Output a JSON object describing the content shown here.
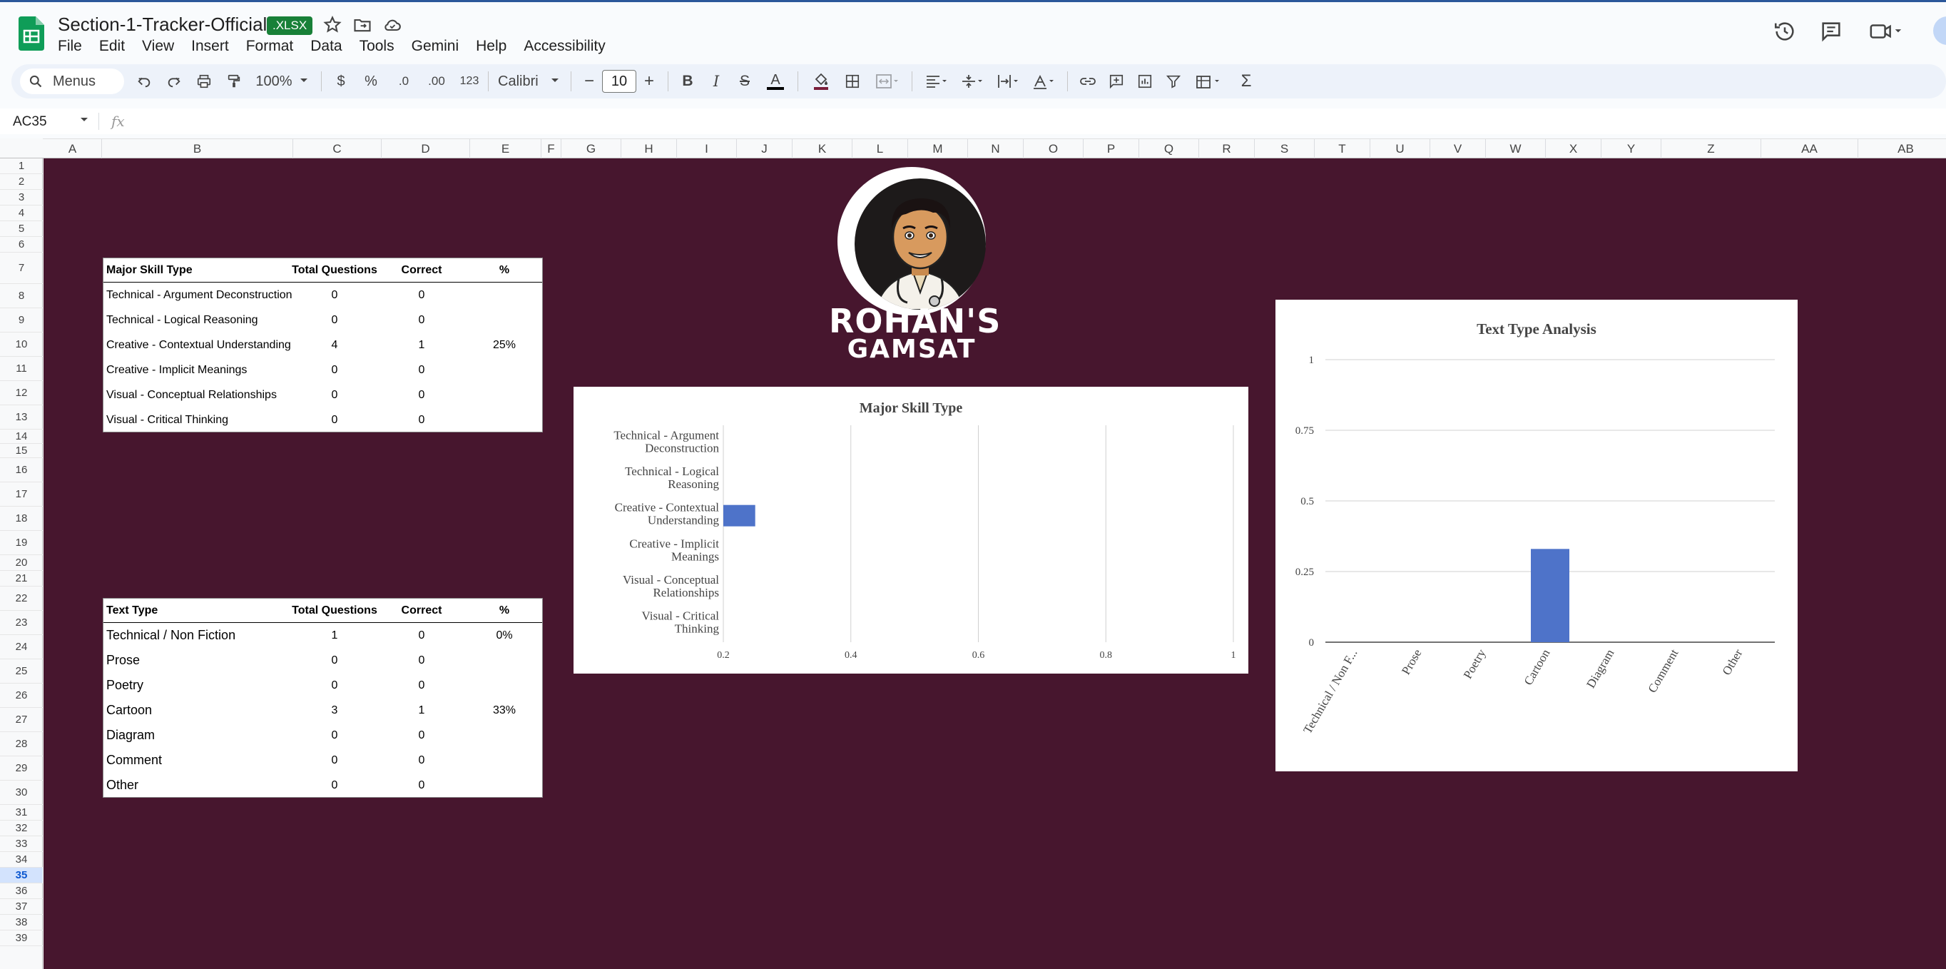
{
  "app": {
    "doc_title": "Section-1-Tracker-Official",
    "format_badge": ".XLSX"
  },
  "menubar": [
    "File",
    "Edit",
    "View",
    "Insert",
    "Format",
    "Data",
    "Tools",
    "Gemini",
    "Help",
    "Accessibility"
  ],
  "toolbar": {
    "menus_label": "Menus",
    "zoom": "100%",
    "currency": "$",
    "percent": "%",
    "decrease_decimal": ".0",
    "increase_decimal": ".00",
    "more_formats": "123",
    "font_family": "Calibri",
    "font_size": "10"
  },
  "formula_bar": {
    "name_box": "AC35",
    "fx": "fx"
  },
  "columns": [
    "A",
    "B",
    "C",
    "D",
    "E",
    "F",
    "G",
    "H",
    "I",
    "J",
    "K",
    "L",
    "M",
    "N",
    "O",
    "P",
    "Q",
    "R",
    "S",
    "T",
    "U",
    "V",
    "W",
    "X",
    "Y",
    "Z",
    "AA",
    "AB"
  ],
  "rows": [
    "1",
    "2",
    "3",
    "4",
    "5",
    "6",
    "7",
    "8",
    "9",
    "10",
    "11",
    "12",
    "13",
    "14",
    "15",
    "16",
    "17",
    "18",
    "19",
    "20",
    "21",
    "22",
    "23",
    "24",
    "25",
    "26",
    "27",
    "28",
    "29",
    "30",
    "31",
    "32",
    "33",
    "34",
    "35",
    "36",
    "37",
    "38",
    "39"
  ],
  "selected_row": "35",
  "skill_table": {
    "headers": [
      "Major Skill Type",
      "Total Questions",
      "Correct",
      "%"
    ],
    "rows": [
      [
        "Technical - Argument Deconstruction",
        "0",
        "0",
        ""
      ],
      [
        "Technical - Logical Reasoning",
        "0",
        "0",
        ""
      ],
      [
        "Creative - Contextual Understanding",
        "4",
        "1",
        "25%"
      ],
      [
        "Creative - Implicit Meanings",
        "0",
        "0",
        ""
      ],
      [
        "Visual - Conceptual Relationships",
        "0",
        "0",
        ""
      ],
      [
        "Visual - Critical Thinking",
        "0",
        "0",
        ""
      ]
    ]
  },
  "text_table": {
    "headers": [
      "Text Type",
      "Total Questions",
      "Correct",
      "%"
    ],
    "rows": [
      [
        "Technical / Non Fiction",
        "1",
        "0",
        "0%"
      ],
      [
        "Prose",
        "0",
        "0",
        ""
      ],
      [
        "Poetry",
        "0",
        "0",
        ""
      ],
      [
        "Cartoon",
        "3",
        "1",
        "33%"
      ],
      [
        "Diagram",
        "0",
        "0",
        ""
      ],
      [
        "Comment",
        "0",
        "0",
        ""
      ],
      [
        "Other",
        "0",
        "0",
        ""
      ]
    ]
  },
  "logo": {
    "line1": "ROHAN'S",
    "line2": "GAMSAT"
  },
  "colors": {
    "sheet_background": "#47162e",
    "bar": "#4e73c9",
    "badge": "#188038"
  },
  "chart_data": [
    {
      "type": "bar",
      "orientation": "horizontal",
      "title": "Major Skill Type",
      "categories": [
        [
          "Technical - Argument",
          "Deconstruction"
        ],
        [
          "Technical - Logical",
          "Reasoning"
        ],
        [
          "Creative - Contextual",
          "Understanding"
        ],
        [
          "Creative - Implicit",
          "Meanings"
        ],
        [
          "Visual - Conceptual",
          "Relationships"
        ],
        [
          "Visual - Critical",
          "Thinking"
        ]
      ],
      "values": [
        0,
        0,
        0.25,
        0,
        0,
        0
      ],
      "xlim": [
        0.2,
        1
      ],
      "xticks": [
        "0.2",
        "0.4",
        "0.6",
        "0.8",
        "1"
      ],
      "grid": true,
      "legend": "none"
    },
    {
      "type": "bar",
      "title": "Text Type Analysis",
      "categories": [
        "Technical / Non F...",
        "Prose",
        "Poetry",
        "Cartoon",
        "Diagram",
        "Comment",
        "Other"
      ],
      "values": [
        0,
        0,
        0,
        0.33,
        0,
        0,
        0
      ],
      "ylim": [
        0,
        1
      ],
      "yticks": [
        "0",
        "0.25",
        "0.5",
        "0.75",
        "1"
      ],
      "grid": true,
      "legend": "none"
    }
  ]
}
